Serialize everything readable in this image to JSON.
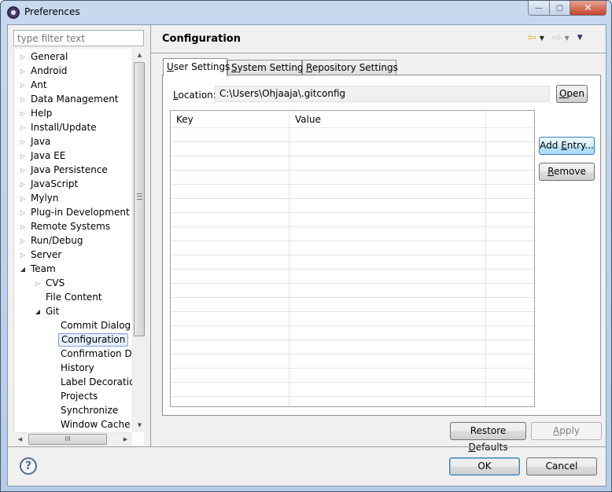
{
  "window": {
    "title": "Preferences",
    "controls": {
      "minimize": "—",
      "maximize": "▢",
      "close": "✕"
    }
  },
  "sidebar": {
    "filter_placeholder": "type filter text",
    "tree": [
      {
        "label": "General",
        "depth": 0,
        "expander": "collapsed"
      },
      {
        "label": "Android",
        "depth": 0,
        "expander": "collapsed"
      },
      {
        "label": "Ant",
        "depth": 0,
        "expander": "collapsed"
      },
      {
        "label": "Data Management",
        "depth": 0,
        "expander": "collapsed"
      },
      {
        "label": "Help",
        "depth": 0,
        "expander": "collapsed"
      },
      {
        "label": "Install/Update",
        "depth": 0,
        "expander": "collapsed"
      },
      {
        "label": "Java",
        "depth": 0,
        "expander": "collapsed"
      },
      {
        "label": "Java EE",
        "depth": 0,
        "expander": "collapsed"
      },
      {
        "label": "Java Persistence",
        "depth": 0,
        "expander": "collapsed"
      },
      {
        "label": "JavaScript",
        "depth": 0,
        "expander": "collapsed"
      },
      {
        "label": "Mylyn",
        "depth": 0,
        "expander": "collapsed"
      },
      {
        "label": "Plug-in Development",
        "depth": 0,
        "expander": "collapsed"
      },
      {
        "label": "Remote Systems",
        "depth": 0,
        "expander": "collapsed"
      },
      {
        "label": "Run/Debug",
        "depth": 0,
        "expander": "collapsed"
      },
      {
        "label": "Server",
        "depth": 0,
        "expander": "collapsed"
      },
      {
        "label": "Team",
        "depth": 0,
        "expander": "expanded"
      },
      {
        "label": "CVS",
        "depth": 1,
        "expander": "collapsed"
      },
      {
        "label": "File Content",
        "depth": 1,
        "expander": "none"
      },
      {
        "label": "Git",
        "depth": 1,
        "expander": "expanded"
      },
      {
        "label": "Commit Dialog",
        "depth": 2,
        "expander": "none"
      },
      {
        "label": "Configuration",
        "depth": 2,
        "expander": "none",
        "selected": true
      },
      {
        "label": "Confirmation Dialogs",
        "depth": 2,
        "expander": "none"
      },
      {
        "label": "History",
        "depth": 2,
        "expander": "none"
      },
      {
        "label": "Label Decorations",
        "depth": 2,
        "expander": "none"
      },
      {
        "label": "Projects",
        "depth": 2,
        "expander": "none"
      },
      {
        "label": "Synchronize",
        "depth": 2,
        "expander": "none"
      },
      {
        "label": "Window Cache",
        "depth": 2,
        "expander": "none"
      }
    ],
    "scroll_grip": "≡",
    "hscroll_grip": "III"
  },
  "page": {
    "title": "Configuration",
    "nav": {
      "back": "⇦",
      "forward": "⇨",
      "dropdown": "▼",
      "menu": "▼"
    },
    "tabs": [
      {
        "label_u": "U",
        "label_rest": "ser Settings",
        "active": true
      },
      {
        "label_u": "S",
        "label_rest": "ystem Settings",
        "active": false
      },
      {
        "label_u": "R",
        "label_rest": "epository Settings",
        "active": false
      }
    ],
    "location": {
      "label_u": "L",
      "label_rest": "ocation:",
      "value": "C:\\Users\\Ohjaaja\\.gitconfig",
      "open_u": "O",
      "open_rest": "pen"
    },
    "table": {
      "columns": [
        "Key",
        "Value",
        ""
      ],
      "rows": []
    },
    "buttons": {
      "add_entry_pre": "Add ",
      "add_entry_u": "E",
      "add_entry_rest": "ntry...",
      "remove_u": "R",
      "remove_rest": "emove",
      "restore_pre": "Restore ",
      "restore_u": "D",
      "restore_rest": "efaults",
      "apply_u": "A",
      "apply_rest": "pply"
    }
  },
  "footer": {
    "help_icon": "?",
    "ok": "OK",
    "cancel": "Cancel"
  }
}
